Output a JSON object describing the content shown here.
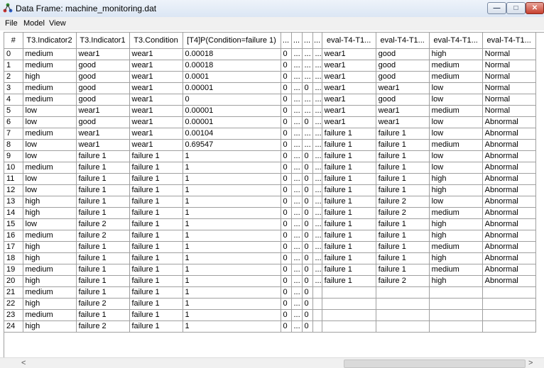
{
  "window": {
    "title": "Data Frame: machine_monitoring.dat"
  },
  "window_controls": {
    "min": "—",
    "max": "□",
    "close": "✕"
  },
  "menu": [
    "File",
    "Model",
    "View"
  ],
  "table": {
    "columns": [
      "#",
      "T3.Indicator2",
      "T3.Indicator1",
      "T3.Condition",
      "[T4]P(Condition=failure 1)",
      "...",
      "...",
      "...",
      "...",
      "eval-T4-T1...",
      "eval-T4-T1...",
      "eval-T4-T1...",
      "eval-T4-T1..."
    ],
    "rows": [
      [
        "0",
        "medium",
        "wear1",
        "wear1",
        "0.00018",
        "0",
        "...",
        "...",
        "...",
        "wear1",
        "good",
        "high",
        "Normal"
      ],
      [
        "1",
        "medium",
        "good",
        "wear1",
        "0.00018",
        "0",
        "...",
        "...",
        "...",
        "wear1",
        "good",
        "medium",
        "Normal"
      ],
      [
        "2",
        "high",
        "good",
        "wear1",
        "0.0001",
        "0",
        "...",
        "...",
        "...",
        "wear1",
        "good",
        "medium",
        "Normal"
      ],
      [
        "3",
        "medium",
        "good",
        "wear1",
        "0.00001",
        "0",
        "...",
        "0",
        "...",
        "wear1",
        "wear1",
        "low",
        "Normal"
      ],
      [
        "4",
        "medium",
        "good",
        "wear1",
        "0",
        "0",
        "...",
        "...",
        "...",
        "wear1",
        "good",
        "low",
        "Normal"
      ],
      [
        "5",
        "low",
        "wear1",
        "wear1",
        "0.00001",
        "0",
        "...",
        "...",
        "...",
        "wear1",
        "wear1",
        "medium",
        "Normal"
      ],
      [
        "6",
        "low",
        "good",
        "wear1",
        "0.00001",
        "0",
        "...",
        "0",
        "...",
        "wear1",
        "wear1",
        "low",
        "Abnormal"
      ],
      [
        "7",
        "medium",
        "wear1",
        "wear1",
        "0.00104",
        "0",
        "...",
        "...",
        "...",
        "failure 1",
        "failure 1",
        "low",
        "Abnormal"
      ],
      [
        "8",
        "low",
        "wear1",
        "wear1",
        "0.69547",
        "0",
        "...",
        "...",
        "...",
        "failure 1",
        "failure 1",
        "medium",
        "Abnormal"
      ],
      [
        "9",
        "low",
        "failure 1",
        "failure 1",
        "1",
        "0",
        "...",
        "0",
        "...",
        "failure 1",
        "failure 1",
        "low",
        "Abnormal"
      ],
      [
        "10",
        "medium",
        "failure 1",
        "failure 1",
        "1",
        "0",
        "...",
        "0",
        "...",
        "failure 1",
        "failure 1",
        "low",
        "Abnormal"
      ],
      [
        "11",
        "low",
        "failure 1",
        "failure 1",
        "1",
        "0",
        "...",
        "0",
        "...",
        "failure 1",
        "failure 1",
        "high",
        "Abnormal"
      ],
      [
        "12",
        "low",
        "failure 1",
        "failure 1",
        "1",
        "0",
        "...",
        "0",
        "...",
        "failure 1",
        "failure 1",
        "high",
        "Abnormal"
      ],
      [
        "13",
        "high",
        "failure 1",
        "failure 1",
        "1",
        "0",
        "...",
        "0",
        "...",
        "failure 1",
        "failure 2",
        "low",
        "Abnormal"
      ],
      [
        "14",
        "high",
        "failure 1",
        "failure 1",
        "1",
        "0",
        "...",
        "0",
        "...",
        "failure 1",
        "failure 2",
        "medium",
        "Abnormal"
      ],
      [
        "15",
        "low",
        "failure 2",
        "failure 1",
        "1",
        "0",
        "...",
        "0",
        "...",
        "failure 1",
        "failure 1",
        "high",
        "Abnormal"
      ],
      [
        "16",
        "medium",
        "failure 2",
        "failure 1",
        "1",
        "0",
        "...",
        "0",
        "...",
        "failure 1",
        "failure 1",
        "high",
        "Abnormal"
      ],
      [
        "17",
        "high",
        "failure 1",
        "failure 1",
        "1",
        "0",
        "...",
        "0",
        "...",
        "failure 1",
        "failure 1",
        "medium",
        "Abnormal"
      ],
      [
        "18",
        "high",
        "failure 1",
        "failure 1",
        "1",
        "0",
        "...",
        "0",
        "...",
        "failure 1",
        "failure 1",
        "high",
        "Abnormal"
      ],
      [
        "19",
        "medium",
        "failure 1",
        "failure 1",
        "1",
        "0",
        "...",
        "0",
        "...",
        "failure 1",
        "failure 1",
        "medium",
        "Abnormal"
      ],
      [
        "20",
        "high",
        "failure 1",
        "failure 1",
        "1",
        "0",
        "...",
        "0",
        "...",
        "failure 1",
        "failure 2",
        "high",
        "Abnormal"
      ],
      [
        "21",
        "medium",
        "failure 1",
        "failure 1",
        "1",
        "0",
        "...",
        "0",
        "",
        "",
        "",
        "",
        ""
      ],
      [
        "22",
        "high",
        "failure 2",
        "failure 1",
        "1",
        "0",
        "...",
        "0",
        "",
        "",
        "",
        "",
        ""
      ],
      [
        "23",
        "medium",
        "failure 1",
        "failure 1",
        "1",
        "0",
        "...",
        "0",
        "",
        "",
        "",
        "",
        ""
      ],
      [
        "24",
        "high",
        "failure 2",
        "failure 1",
        "1",
        "0",
        "...",
        "0",
        "",
        "",
        "",
        "",
        ""
      ]
    ]
  },
  "scrollbar": {
    "left_arrow": "<",
    "right_arrow": ">"
  },
  "colors": {
    "shaded_cell": "#c0c0c0",
    "grid_line": "#a0a0a0"
  }
}
